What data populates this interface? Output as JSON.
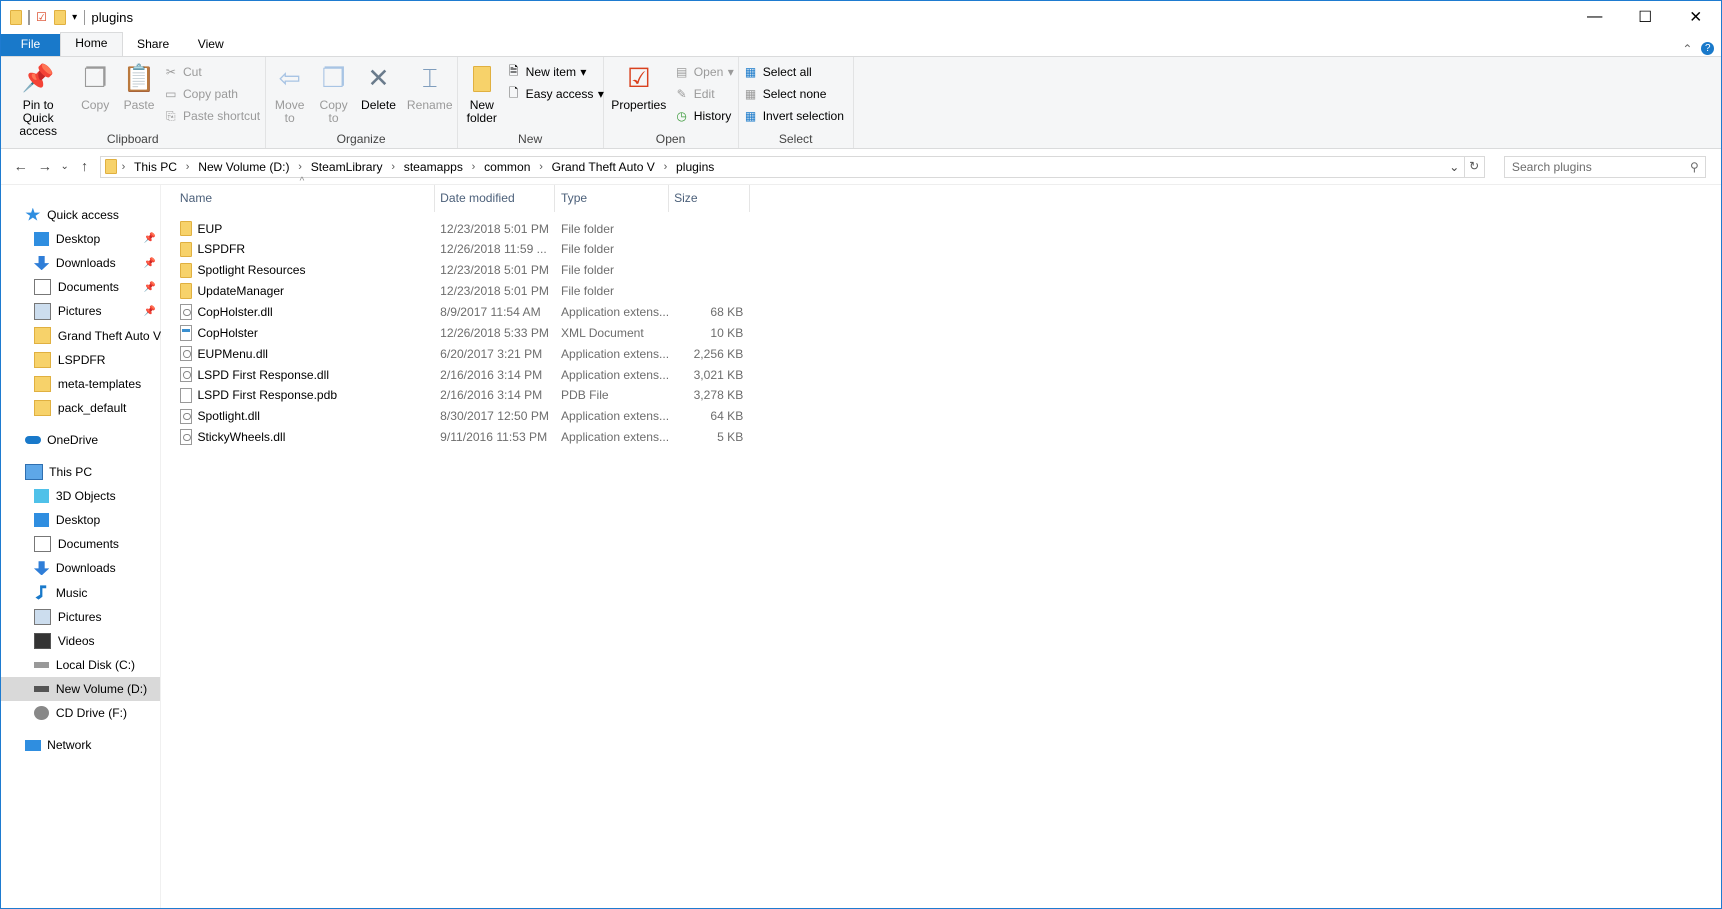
{
  "window": {
    "title": "plugins",
    "minimize": "—",
    "maximize": "☐",
    "close": "✕"
  },
  "tabs": [
    {
      "label": "File"
    },
    {
      "label": "Home"
    },
    {
      "label": "Share"
    },
    {
      "label": "View"
    }
  ],
  "ribbon": {
    "clipboard": {
      "label": "Clipboard",
      "pin": "Pin to Quick access",
      "copy": "Copy",
      "paste": "Paste",
      "cut": "Cut",
      "copy_path": "Copy path",
      "paste_shortcut": "Paste shortcut"
    },
    "organize": {
      "label": "Organize",
      "move_to": "Move to",
      "copy_to": "Copy to",
      "delete": "Delete",
      "rename": "Rename"
    },
    "new": {
      "label": "New",
      "new_folder": "New folder",
      "new_item": "New item",
      "easy_access": "Easy access"
    },
    "open": {
      "label": "Open",
      "properties": "Properties",
      "open": "Open",
      "edit": "Edit",
      "history": "History"
    },
    "select": {
      "label": "Select",
      "select_all": "Select all",
      "select_none": "Select none",
      "invert": "Invert selection"
    }
  },
  "address": {
    "crumbs": [
      "This PC",
      "New Volume (D:)",
      "SteamLibrary",
      "steamapps",
      "common",
      "Grand Theft Auto V",
      "plugins"
    ],
    "search_placeholder": "Search plugins"
  },
  "sidebar": {
    "quick_access": "Quick access",
    "quick_items": [
      {
        "label": "Desktop",
        "pinned": true,
        "icon": "desktop-icon"
      },
      {
        "label": "Downloads",
        "pinned": true,
        "icon": "downloads-icon"
      },
      {
        "label": "Documents",
        "pinned": true,
        "icon": "documents-icon"
      },
      {
        "label": "Pictures",
        "pinned": true,
        "icon": "pictures-icon"
      },
      {
        "label": "Grand Theft Auto V",
        "icon": "folder-icon"
      },
      {
        "label": "LSPDFR",
        "icon": "folder-icon"
      },
      {
        "label": "meta-templates",
        "icon": "folder-icon"
      },
      {
        "label": "pack_default",
        "icon": "folder-icon"
      }
    ],
    "onedrive": "OneDrive",
    "this_pc": "This PC",
    "pc_items": [
      {
        "label": "3D Objects"
      },
      {
        "label": "Desktop"
      },
      {
        "label": "Documents"
      },
      {
        "label": "Downloads"
      },
      {
        "label": "Music"
      },
      {
        "label": "Pictures"
      },
      {
        "label": "Videos"
      },
      {
        "label": "Local Disk (C:)"
      },
      {
        "label": "New Volume (D:)",
        "selected": true
      },
      {
        "label": "CD Drive (F:)"
      }
    ],
    "network": "Network"
  },
  "columns": {
    "name": "Name",
    "date": "Date modified",
    "type": "Type",
    "size": "Size"
  },
  "files": [
    {
      "name": "EUP",
      "date": "12/23/2018 5:01 PM",
      "type": "File folder",
      "size": "",
      "kind": "folder"
    },
    {
      "name": "LSPDFR",
      "date": "12/26/2018 11:59 ...",
      "type": "File folder",
      "size": "",
      "kind": "folder"
    },
    {
      "name": "Spotlight Resources",
      "date": "12/23/2018 5:01 PM",
      "type": "File folder",
      "size": "",
      "kind": "folder"
    },
    {
      "name": "UpdateManager",
      "date": "12/23/2018 5:01 PM",
      "type": "File folder",
      "size": "",
      "kind": "folder"
    },
    {
      "name": "CopHolster.dll",
      "date": "8/9/2017 11:54 AM",
      "type": "Application extens...",
      "size": "68 KB",
      "kind": "dll"
    },
    {
      "name": "CopHolster",
      "date": "12/26/2018 5:33 PM",
      "type": "XML Document",
      "size": "10 KB",
      "kind": "xml"
    },
    {
      "name": "EUPMenu.dll",
      "date": "6/20/2017 3:21 PM",
      "type": "Application extens...",
      "size": "2,256 KB",
      "kind": "dll"
    },
    {
      "name": "LSPD First Response.dll",
      "date": "2/16/2016 3:14 PM",
      "type": "Application extens...",
      "size": "3,021 KB",
      "kind": "dll"
    },
    {
      "name": "LSPD First Response.pdb",
      "date": "2/16/2016 3:14 PM",
      "type": "PDB File",
      "size": "3,278 KB",
      "kind": "file"
    },
    {
      "name": "Spotlight.dll",
      "date": "8/30/2017 12:50 PM",
      "type": "Application extens...",
      "size": "64 KB",
      "kind": "dll"
    },
    {
      "name": "StickyWheels.dll",
      "date": "9/11/2016 11:53 PM",
      "type": "Application extens...",
      "size": "5 KB",
      "kind": "dll"
    }
  ],
  "colors": {
    "accent": "#1979ca",
    "ribbon_bg": "#f5f6f7",
    "folder": "#f7d26a",
    "selected": "#d9d9d9"
  }
}
